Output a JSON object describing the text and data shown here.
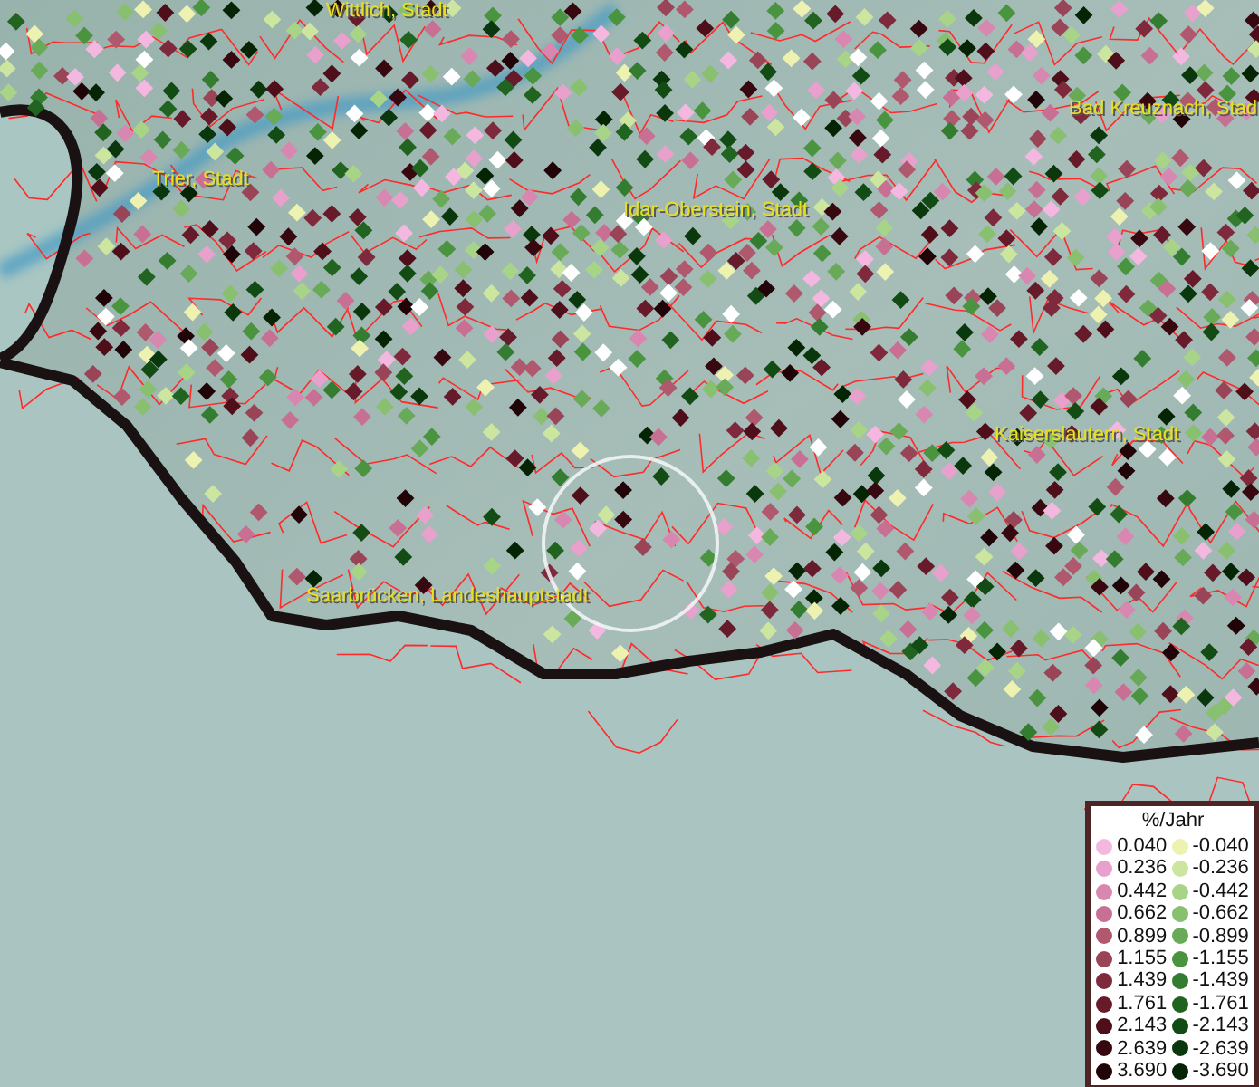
{
  "map": {
    "places": [
      {
        "name": "Wittlich, Stadt"
      },
      {
        "name": "Trier, Stadt"
      },
      {
        "name": "Idar-Oberstein, Stadt"
      },
      {
        "name": "Bad Kreuznach, Stad"
      },
      {
        "name": "Kaiserslautern, Stadt"
      },
      {
        "name": "Saarbrücken, Landeshauptstadt"
      }
    ]
  },
  "legend": {
    "title": "%/Jahr",
    "rows": [
      {
        "positive": {
          "label": "0.040",
          "color": "#f4b8e0"
        },
        "negative": {
          "label": "-0.040",
          "color": "#eef2b0"
        }
      },
      {
        "positive": {
          "label": "0.236",
          "color": "#e8a0cc"
        },
        "negative": {
          "label": "-0.236",
          "color": "#cce6a0"
        }
      },
      {
        "positive": {
          "label": "0.442",
          "color": "#d888b0"
        },
        "negative": {
          "label": "-0.442",
          "color": "#a8d488"
        }
      },
      {
        "positive": {
          "label": "0.662",
          "color": "#c87094"
        },
        "negative": {
          "label": "-0.662",
          "color": "#88c070"
        }
      },
      {
        "positive": {
          "label": "0.899",
          "color": "#b0586e"
        },
        "negative": {
          "label": "-0.899",
          "color": "#68aa58"
        }
      },
      {
        "positive": {
          "label": "1.155",
          "color": "#9a4458"
        },
        "negative": {
          "label": "-1.155",
          "color": "#4a9440"
        }
      },
      {
        "positive": {
          "label": "1.439",
          "color": "#7e2a3c"
        },
        "negative": {
          "label": "-1.439",
          "color": "#347c30"
        }
      },
      {
        "positive": {
          "label": "1.761",
          "color": "#661a2a"
        },
        "negative": {
          "label": "-1.761",
          "color": "#206420"
        }
      },
      {
        "positive": {
          "label": "2.143",
          "color": "#4e0e1a"
        },
        "negative": {
          "label": "-2.143",
          "color": "#124c14"
        }
      },
      {
        "positive": {
          "label": "2.639",
          "color": "#380810"
        },
        "negative": {
          "label": "-2.639",
          "color": "#0a380c"
        }
      },
      {
        "positive": {
          "label": "3.690",
          "color": "#200408"
        },
        "negative": {
          "label": "-3.690",
          "color": "#042404"
        }
      }
    ]
  }
}
